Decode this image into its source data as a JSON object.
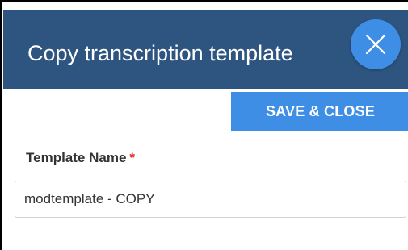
{
  "dialog": {
    "title": "Copy transcription template",
    "close_icon": "close-icon"
  },
  "toolbar": {
    "save_close_label": "SAVE & CLOSE"
  },
  "form": {
    "template_name": {
      "label": "Template Name",
      "required_marker": "*",
      "value": "modtemplate - COPY"
    }
  },
  "colors": {
    "header_bg": "#2e5480",
    "accent": "#3f8ee6",
    "required": "#e0302b"
  }
}
